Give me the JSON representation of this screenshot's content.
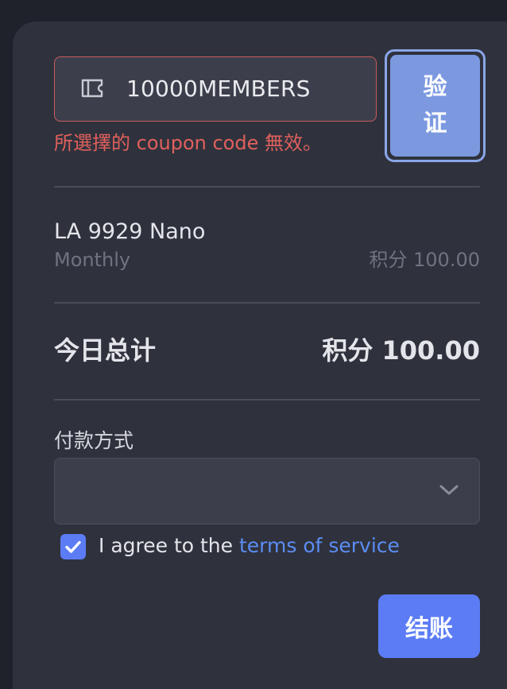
{
  "coupon": {
    "value": "10000MEMBERS",
    "error_message": "所選擇的 coupon code 無效。",
    "verify_label": "验证"
  },
  "order": {
    "plan_name": "LA 9929 Nano",
    "billing_period": "Monthly",
    "plan_price": "积分 100.00",
    "total_label": "今日总计",
    "total_value": "积分 100.00"
  },
  "payment": {
    "label": "付款方式",
    "selected_value": ""
  },
  "agreement": {
    "checked": true,
    "text": "I agree to the ",
    "link_text": "terms of service"
  },
  "actions": {
    "checkout_label": "结账"
  },
  "colors": {
    "page_background": "#1f222b",
    "card_background": "#2f323d",
    "input_background": "#3c3f4b",
    "error": "#e0605c",
    "accent": "#5c7cf5",
    "verify_button": "#7c99e0",
    "link": "#5b8df3"
  },
  "icons": {
    "coupon": "ticket-icon",
    "select": "chevron-down-icon",
    "checkbox": "checkmark-icon"
  }
}
